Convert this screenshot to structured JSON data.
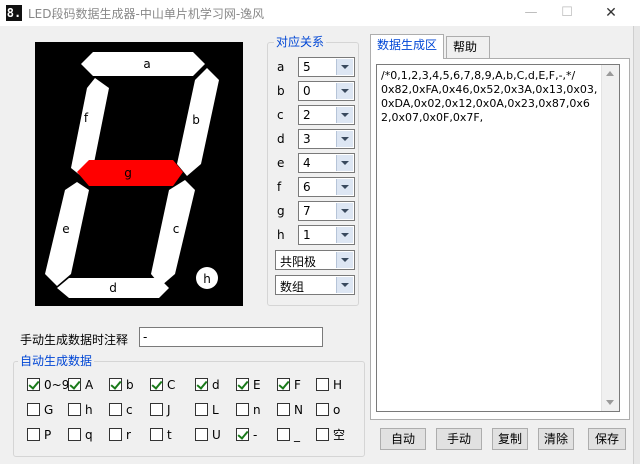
{
  "window": {
    "title": "LED段码数据生成器-中山单片机学习网-逸风",
    "icon_text": "8.",
    "minimize": "—",
    "maximize": "☐",
    "close": "✕"
  },
  "segment_display": {
    "labels": {
      "a": "a",
      "b": "b",
      "c": "c",
      "d": "d",
      "e": "e",
      "f": "f",
      "g": "g",
      "h": "h"
    },
    "active_segment": "g",
    "colors": {
      "background": "#000000",
      "segment_off": "#ffffff",
      "segment_on": "#ff0000"
    }
  },
  "mapping": {
    "title": "对应关系",
    "rows": [
      {
        "label": "a",
        "value": "5"
      },
      {
        "label": "b",
        "value": "0"
      },
      {
        "label": "c",
        "value": "2"
      },
      {
        "label": "d",
        "value": "3"
      },
      {
        "label": "e",
        "value": "4"
      },
      {
        "label": "f",
        "value": "6"
      },
      {
        "label": "g",
        "value": "7"
      },
      {
        "label": "h",
        "value": "1"
      }
    ],
    "polarity": "共阳极",
    "format": "数组"
  },
  "note": {
    "label": "手动生成数据时注释",
    "value": "-"
  },
  "auto_gen": {
    "title": "自动生成数据",
    "items": [
      {
        "label": "0~9",
        "checked": true
      },
      {
        "label": "A",
        "checked": true
      },
      {
        "label": "b",
        "checked": true
      },
      {
        "label": "C",
        "checked": true
      },
      {
        "label": "d",
        "checked": true
      },
      {
        "label": "E",
        "checked": true
      },
      {
        "label": "F",
        "checked": true
      },
      {
        "label": "H",
        "checked": false
      },
      {
        "label": "G",
        "checked": false
      },
      {
        "label": "h",
        "checked": false
      },
      {
        "label": "c",
        "checked": false
      },
      {
        "label": "J",
        "checked": false
      },
      {
        "label": "L",
        "checked": false
      },
      {
        "label": "n",
        "checked": false
      },
      {
        "label": "N",
        "checked": false
      },
      {
        "label": "o",
        "checked": false
      },
      {
        "label": "P",
        "checked": false
      },
      {
        "label": "q",
        "checked": false
      },
      {
        "label": "r",
        "checked": false
      },
      {
        "label": "t",
        "checked": false
      },
      {
        "label": "U",
        "checked": false
      },
      {
        "label": "-",
        "checked": true
      },
      {
        "label": "_",
        "checked": false
      },
      {
        "label": "空",
        "checked": false
      }
    ]
  },
  "tabs": [
    {
      "label": "数据生成区",
      "active": true
    },
    {
      "label": "帮助",
      "active": false
    }
  ],
  "output": {
    "text": "/*0,1,2,3,4,5,6,7,8,9,A,b,C,d,E,F,-,*/\n0x82,0xFA,0x46,0x52,0x3A,0x13,0x03,0xDA,0x02,0x12,0x0A,0x23,0x87,0x62,0x07,0x0F,0x7F,"
  },
  "buttons": {
    "auto": "自动",
    "manual": "手动",
    "copy": "复制",
    "clear": "清除",
    "save": "保存"
  }
}
